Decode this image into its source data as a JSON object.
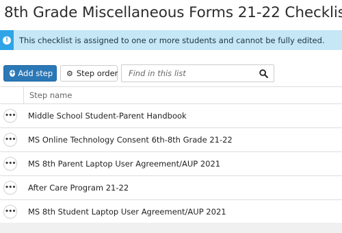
{
  "header": {
    "title": "8th Grade Miscellaneous Forms 21-22 Checklist"
  },
  "alert": {
    "icon": "exclamation-circle-icon",
    "message": "This checklist is assigned to one or more students and cannot be fully edited.",
    "color": "#c5e7f6",
    "accent": "#2fa4e7"
  },
  "toolbar": {
    "add_step_label": "Add step",
    "step_order_label": "Step order",
    "search_placeholder": "Find in this list",
    "primary_color": "#2b78b7"
  },
  "table": {
    "column_header": "Step name",
    "row_menu_glyph": "•••",
    "rows": [
      {
        "label": "Middle School Student-Parent Handbook"
      },
      {
        "label": "MS Online Technology Consent 6th-8th Grade 21-22"
      },
      {
        "label": "MS 8th Parent Laptop User Agreement/AUP 2021"
      },
      {
        "label": "After Care Program 21-22"
      },
      {
        "label": "MS 8th Student Laptop User Agreement/AUP 2021"
      }
    ]
  }
}
